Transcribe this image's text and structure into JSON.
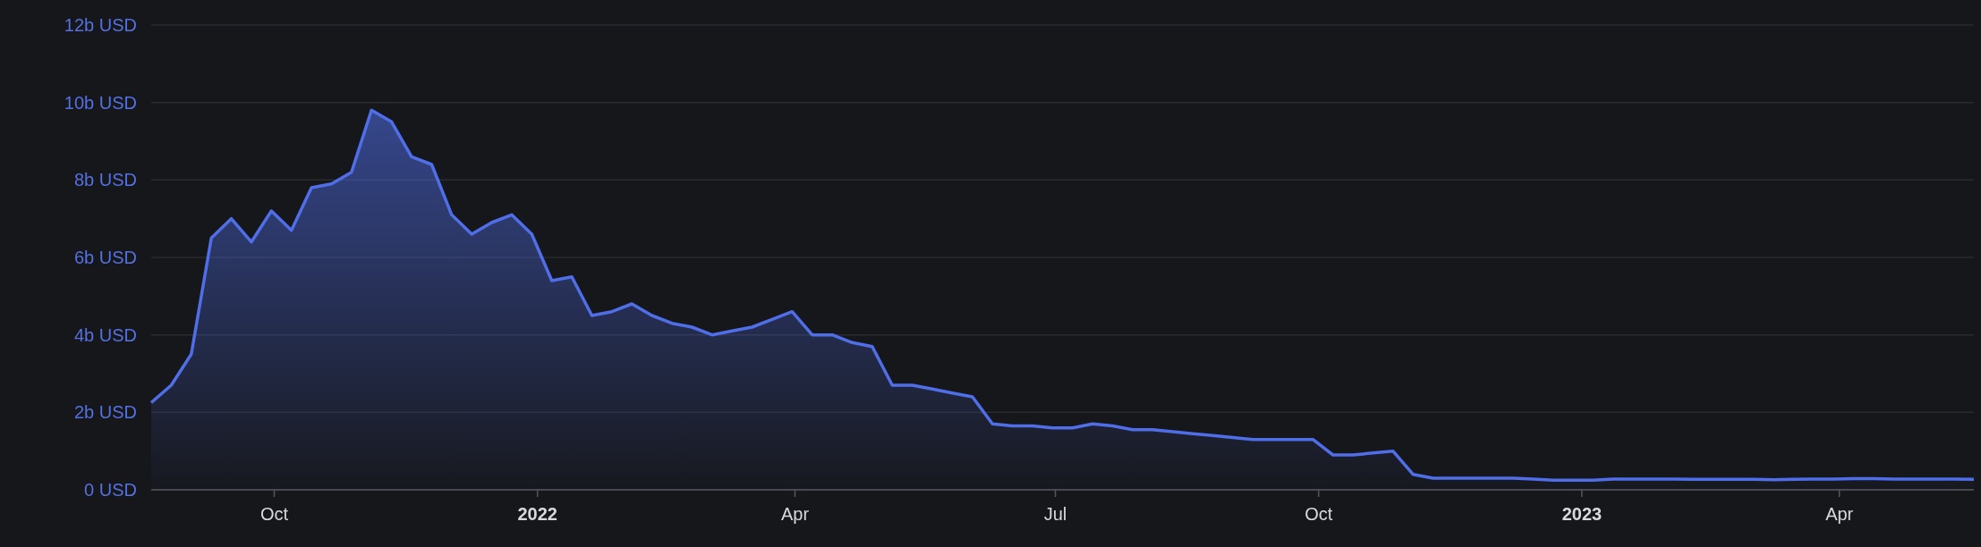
{
  "chart_data": {
    "type": "area",
    "grid": true,
    "xlim": [
      "2021-08-19",
      "2023-05-18"
    ],
    "ylim": [
      0,
      12
    ],
    "yticks": [
      {
        "value": 0,
        "label": "0 USD"
      },
      {
        "value": 2,
        "label": "2b USD"
      },
      {
        "value": 4,
        "label": "4b USD"
      },
      {
        "value": 6,
        "label": "6b USD"
      },
      {
        "value": 8,
        "label": "8b USD"
      },
      {
        "value": 10,
        "label": "10b USD"
      },
      {
        "value": 12,
        "label": "12b USD"
      }
    ],
    "xticks": [
      {
        "value": "2021-10-01",
        "label": "Oct"
      },
      {
        "value": "2022-01-01",
        "label": "2022"
      },
      {
        "value": "2022-04-01",
        "label": "Apr"
      },
      {
        "value": "2022-07-01",
        "label": "Jul"
      },
      {
        "value": "2022-10-01",
        "label": "Oct"
      },
      {
        "value": "2023-01-01",
        "label": "2023"
      },
      {
        "value": "2023-04-01",
        "label": "Apr"
      }
    ],
    "x": [
      "2021-08-19",
      "2021-08-26",
      "2021-09-02",
      "2021-09-09",
      "2021-09-16",
      "2021-09-23",
      "2021-09-30",
      "2021-10-07",
      "2021-10-14",
      "2021-10-21",
      "2021-10-28",
      "2021-11-04",
      "2021-11-11",
      "2021-11-18",
      "2021-11-25",
      "2021-12-02",
      "2021-12-09",
      "2021-12-16",
      "2021-12-23",
      "2021-12-30",
      "2022-01-06",
      "2022-01-13",
      "2022-01-20",
      "2022-01-27",
      "2022-02-03",
      "2022-02-10",
      "2022-02-17",
      "2022-02-24",
      "2022-03-03",
      "2022-03-10",
      "2022-03-17",
      "2022-03-24",
      "2022-03-31",
      "2022-04-07",
      "2022-04-14",
      "2022-04-21",
      "2022-04-28",
      "2022-05-05",
      "2022-05-12",
      "2022-05-19",
      "2022-05-26",
      "2022-06-02",
      "2022-06-09",
      "2022-06-16",
      "2022-06-23",
      "2022-06-30",
      "2022-07-07",
      "2022-07-14",
      "2022-07-21",
      "2022-07-28",
      "2022-08-04",
      "2022-08-11",
      "2022-08-18",
      "2022-08-25",
      "2022-09-01",
      "2022-09-08",
      "2022-09-15",
      "2022-09-22",
      "2022-09-29",
      "2022-10-06",
      "2022-10-13",
      "2022-10-20",
      "2022-10-27",
      "2022-11-03",
      "2022-11-10",
      "2022-11-17",
      "2022-11-24",
      "2022-12-01",
      "2022-12-08",
      "2022-12-15",
      "2022-12-22",
      "2022-12-29",
      "2023-01-05",
      "2023-01-12",
      "2023-01-19",
      "2023-01-26",
      "2023-02-02",
      "2023-02-09",
      "2023-02-16",
      "2023-02-23",
      "2023-03-02",
      "2023-03-09",
      "2023-03-16",
      "2023-03-23",
      "2023-03-30",
      "2023-04-06",
      "2023-04-13",
      "2023-04-20",
      "2023-04-27",
      "2023-05-04",
      "2023-05-11",
      "2023-05-18"
    ],
    "series": [
      {
        "color": "#4f6ee8",
        "values": [
          2.25,
          2.7,
          3.5,
          6.5,
          7.0,
          6.4,
          7.2,
          6.7,
          7.8,
          7.9,
          8.2,
          9.8,
          9.5,
          8.6,
          8.4,
          7.1,
          6.6,
          6.9,
          7.1,
          6.6,
          5.4,
          5.5,
          4.5,
          4.6,
          4.8,
          4.5,
          4.3,
          4.2,
          4.0,
          4.1,
          4.2,
          4.4,
          4.6,
          4.0,
          4.0,
          3.8,
          3.7,
          2.7,
          2.7,
          2.6,
          2.5,
          2.4,
          1.7,
          1.65,
          1.65,
          1.6,
          1.6,
          1.7,
          1.65,
          1.55,
          1.55,
          1.5,
          1.45,
          1.4,
          1.35,
          1.3,
          1.3,
          1.3,
          1.3,
          0.9,
          0.9,
          0.95,
          1.0,
          0.4,
          0.3,
          0.3,
          0.3,
          0.3,
          0.3,
          0.28,
          0.25,
          0.25,
          0.25,
          0.28,
          0.28,
          0.28,
          0.28,
          0.27,
          0.27,
          0.27,
          0.27,
          0.26,
          0.27,
          0.28,
          0.28,
          0.29,
          0.29,
          0.28,
          0.28,
          0.28,
          0.28,
          0.27
        ]
      }
    ]
  }
}
